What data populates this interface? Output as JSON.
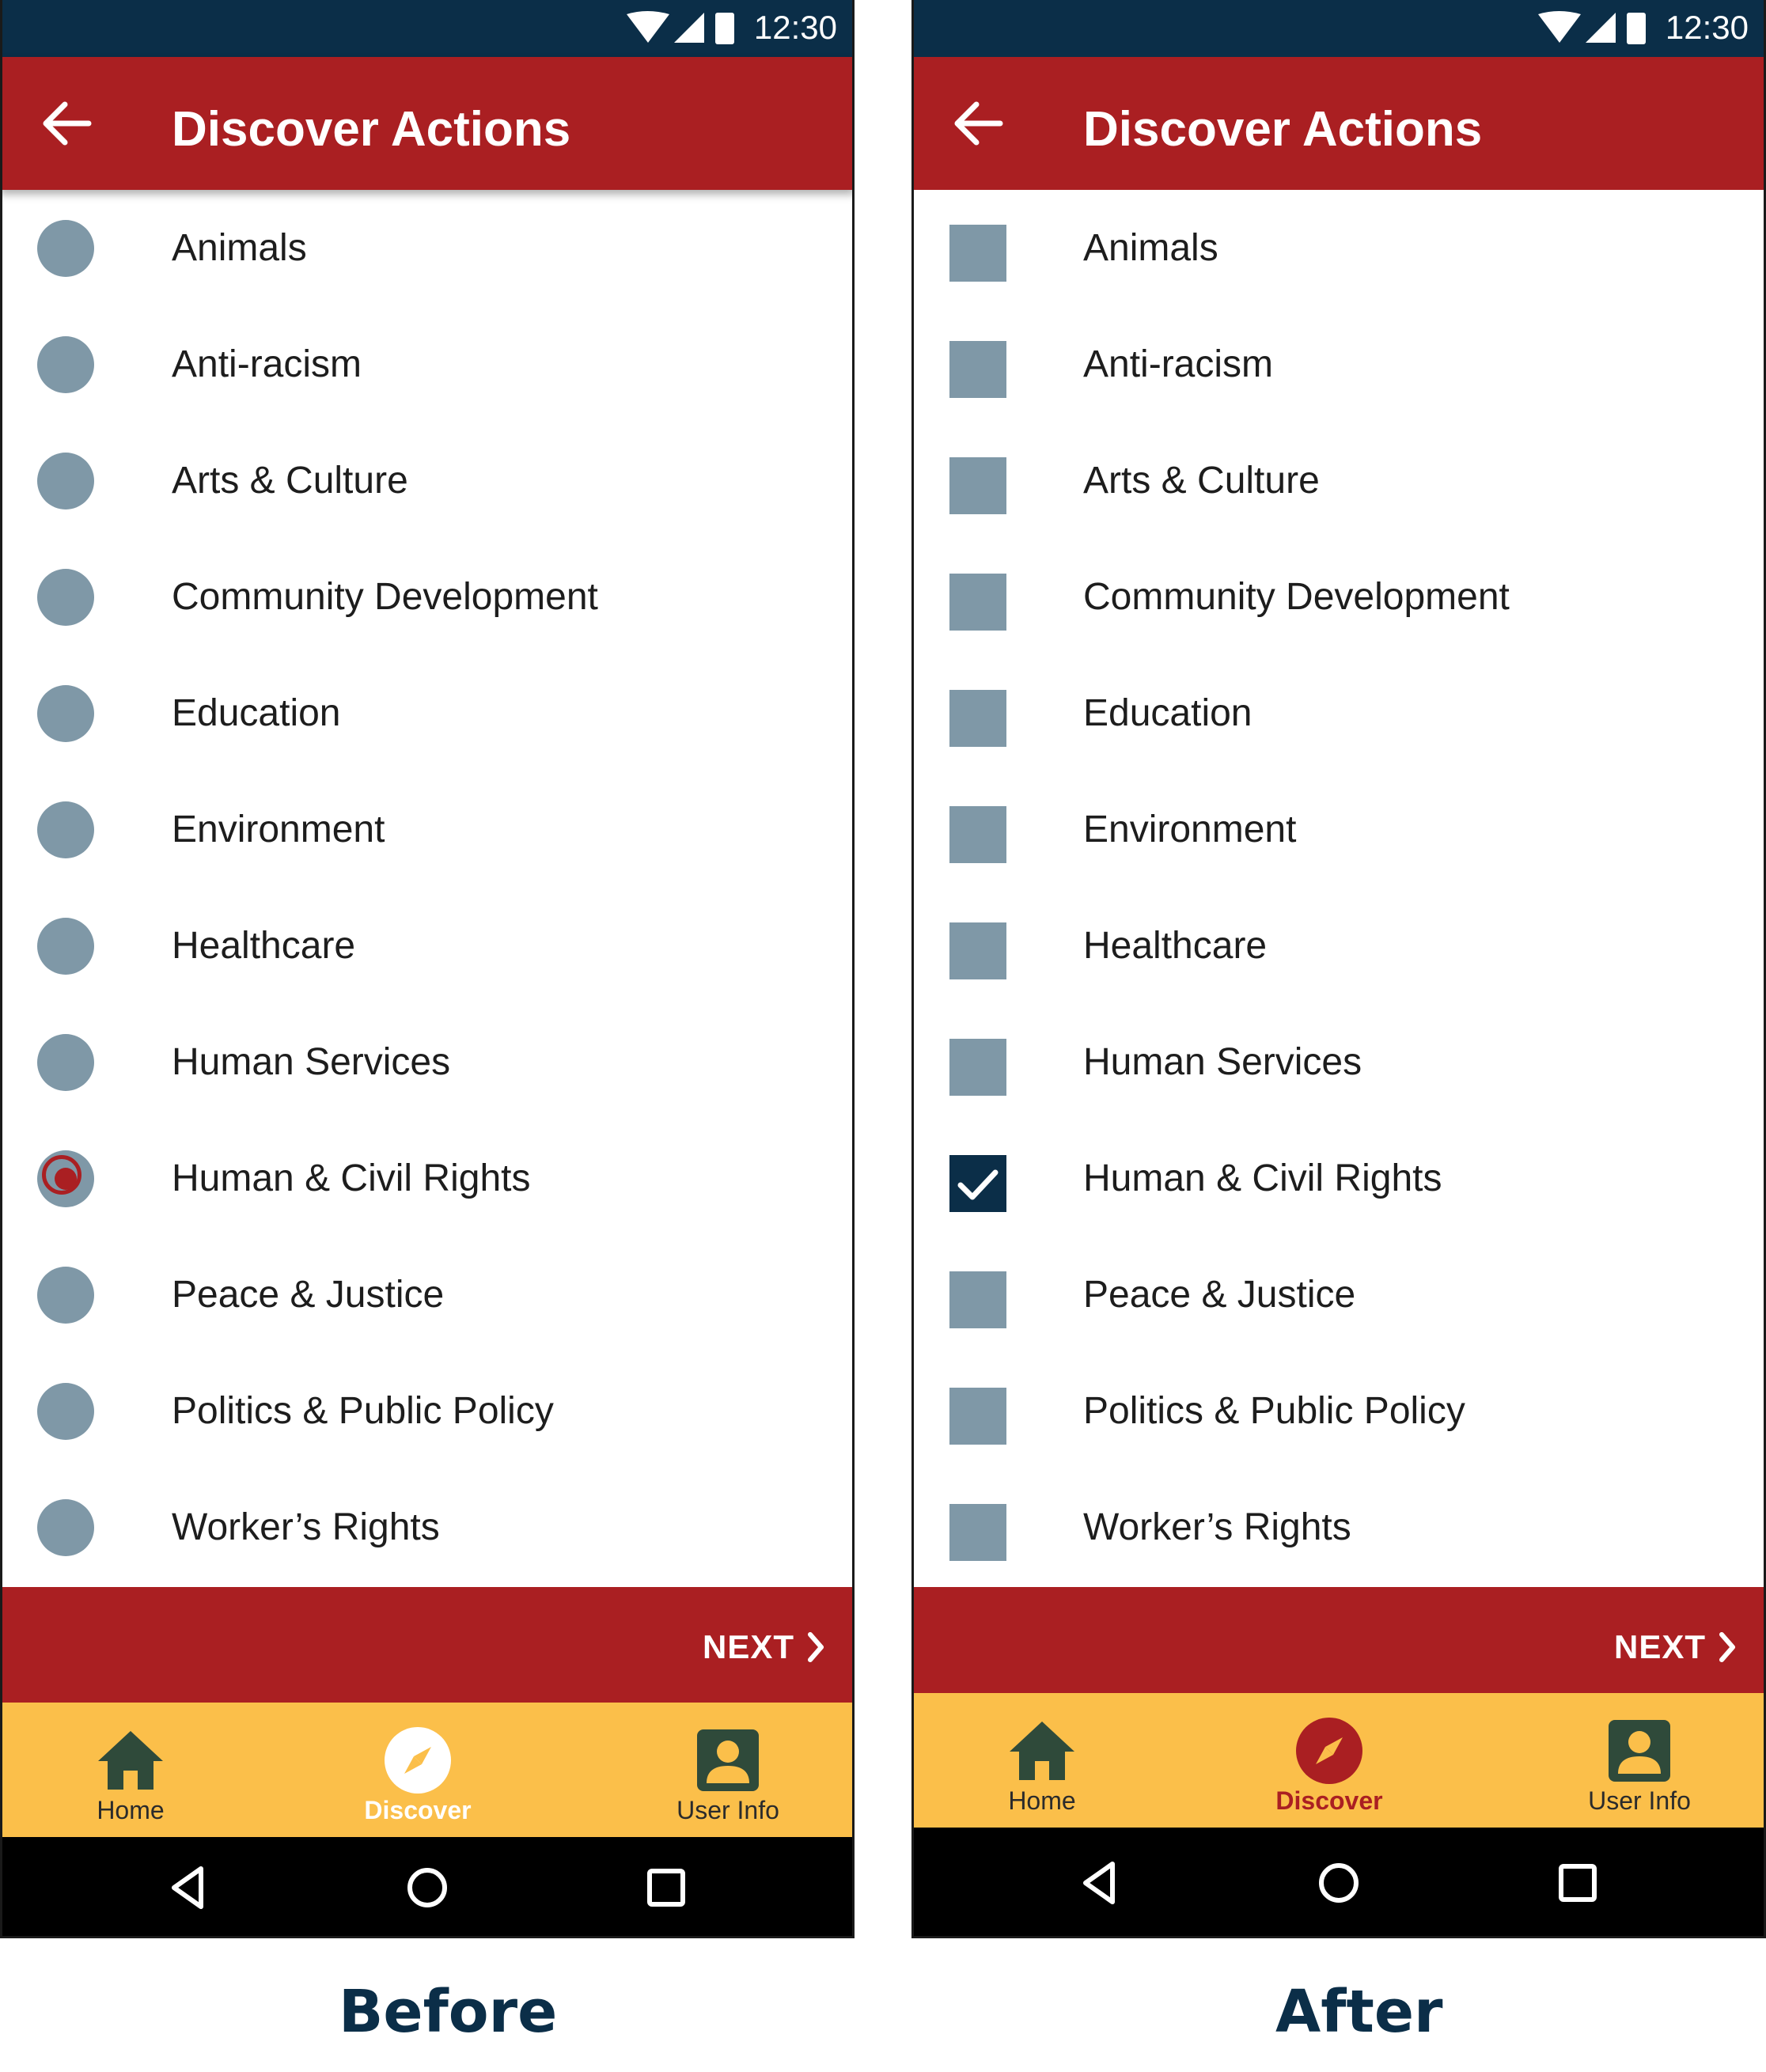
{
  "status_bar": {
    "time": "12:30",
    "icons": [
      "wifi-icon",
      "signal-icon",
      "battery-icon"
    ]
  },
  "colors": {
    "status_bar": "#0b2e48",
    "app_bar": "#aa1f22",
    "accent_red": "#aa1f22",
    "control_gray": "#7f98a7",
    "checked_navy": "#0b2e48",
    "bottom_nav": "#fbbf4a",
    "nav_icon": "#2f4a3a",
    "caption": "#0b2e48"
  },
  "before": {
    "title": "Discover Actions",
    "caption": "Before",
    "selected": "Human & Civil Rights",
    "next_label": "NEXT",
    "nav": {
      "home": "Home",
      "discover": "Discover",
      "user_info": "User Info",
      "active": "Discover"
    }
  },
  "after": {
    "title": "Discover Actions",
    "caption": "After",
    "selected": "Human & Civil Rights",
    "next_label": "NEXT",
    "nav": {
      "home": "Home",
      "discover": "Discover",
      "user_info": "User Info",
      "active": "Discover"
    }
  },
  "categories": [
    "Animals",
    "Anti-racism",
    "Arts & Culture",
    "Community Development",
    "Education",
    "Environment",
    "Healthcare",
    "Human Services",
    "Human & Civil Rights",
    "Peace & Justice",
    "Politics & Public Policy",
    "Worker’s Rights"
  ]
}
